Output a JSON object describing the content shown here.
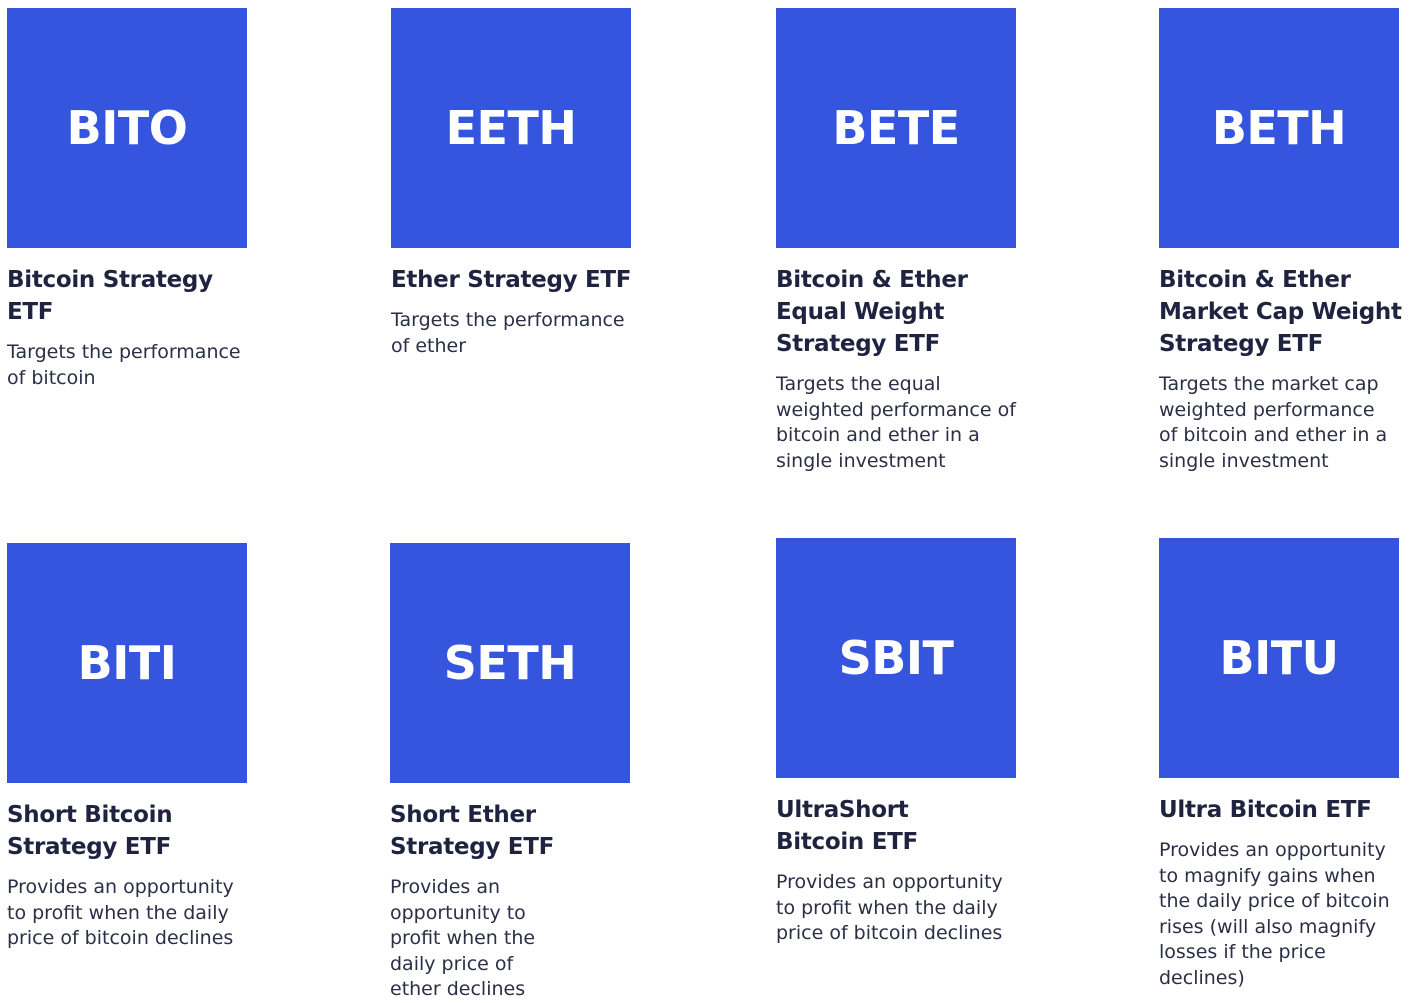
{
  "colors": {
    "tile_background": "#3555df",
    "ticker_text": "#ffffff",
    "title_text": "#1f2340",
    "description_text": "#2a2f45"
  },
  "products": [
    {
      "ticker": "BITO",
      "name": "Bitcoin Strategy ETF",
      "description": "Targets the performance of bitcoin"
    },
    {
      "ticker": "EETH",
      "name": "Ether Strategy ETF",
      "description": "Targets the performance of ether"
    },
    {
      "ticker": "BETE",
      "name": "Bitcoin & Ether Equal Weight Strategy ETF",
      "description": "Targets the equal weighted performance of bitcoin and ether in a single investment"
    },
    {
      "ticker": "BETH",
      "name": "Bitcoin & Ether Market Cap Weight Strategy ETF",
      "description": "Targets the market cap weighted performance of bitcoin and ether in a single investment"
    },
    {
      "ticker": "BITI",
      "name": "Short Bitcoin Strategy ETF",
      "description": "Provides an opportunity to profit when the daily price of bitcoin declines"
    },
    {
      "ticker": "SETH",
      "name": "Short Ether Strategy ETF",
      "description": "Provides an opportunity to profit when the daily price of ether declines"
    },
    {
      "ticker": "SBIT",
      "name": "UltraShort Bitcoin ETF",
      "description": "Provides an opportunity to profit when the daily price of bitcoin declines"
    },
    {
      "ticker": "BITU",
      "name": "Ultra Bitcoin ETF",
      "description": "Provides an opportunity to magnify gains when the daily price of bitcoin rises (will also magnify losses if the price declines)"
    }
  ]
}
